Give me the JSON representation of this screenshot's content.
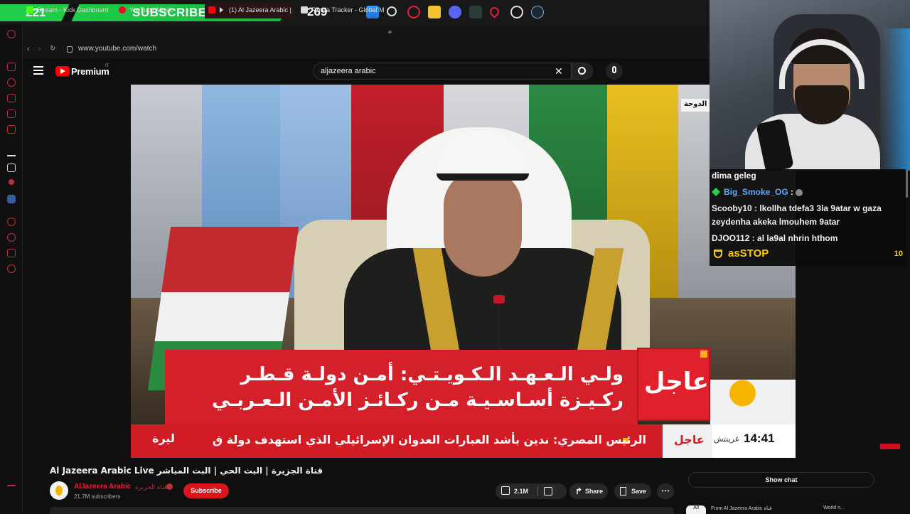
{
  "overlay": {
    "subscriber_count": "221",
    "subscribers_label": "SUBSCRIBERS",
    "goal": "269"
  },
  "tabs": [
    {
      "label": "Stream - Kick Dashboard",
      "icon": "kick-icon"
    },
    {
      "label": "YouTube Music",
      "icon": "youtube-music-icon"
    },
    {
      "label": "(1) Al Jazeera Arabic |",
      "icon": "youtube-icon",
      "active": true
    },
    {
      "label": "Flotilla Tracker - Global M",
      "icon": "flotilla-icon"
    }
  ],
  "address_bar": {
    "url": "www.youtube.com/watch"
  },
  "youtube": {
    "logo_text": "Premium",
    "region": "IT",
    "search_value": "aljazeera arabic"
  },
  "video": {
    "breaking_label": "عاجل",
    "headline_line1": "ولـي الـعـهـد الـكـويـتـي: أمـن دولـة قـطـر",
    "headline_line2": "ركـيـزة أسـاسـيـة مـن ركـائـز الأمـن الـعـربـي",
    "ticker_text": "الرئيس المصري: ندين بأشد العبارات العدوان الإسرائيلي الذي استهدف دولة ق",
    "ticker_prefix": "ليرة",
    "ticker_label": "عاجل",
    "ticker_time": "14:41",
    "ticker_city": "غرينتش",
    "location_tag": "الدوحة"
  },
  "watch": {
    "title": "Al Jazeera Arabic Live قناة الجزيرة | البث الحي | البث المباشر",
    "channel_name": "AlJazeera Arabic",
    "channel_name_ar": "قناة الجزيرة",
    "subscribers": "21.7M subscribers",
    "subscribe_label": "Subscribe",
    "likes": "2.1M",
    "share_label": "Share",
    "save_label": "Save",
    "show_chat_label": "Show chat",
    "chip_all": "All",
    "chip_from": "From Al Jazeera Arabic قناة",
    "chip_world": "World n..."
  },
  "chat": {
    "lines": [
      {
        "user": "dima geleg",
        "message": ""
      },
      {
        "user": "Big_Smoke_OG",
        "message": ":"
      },
      {
        "user": "Scooby10",
        "message": ": lkollha tdefa3 3la 9atar w gaza"
      },
      {
        "user": "",
        "message": "zeydenha akeka lmouhem 9atar"
      },
      {
        "user": "DJOO112",
        "message": ": al la9al nhrin hthom"
      }
    ],
    "top_user": "asSTOP",
    "top_count": "10"
  },
  "colors": {
    "accent_red": "#d11c26",
    "youtube_red": "#ff0000",
    "sub_green": "#21d04a",
    "chat_gold": "#ffcc00"
  }
}
